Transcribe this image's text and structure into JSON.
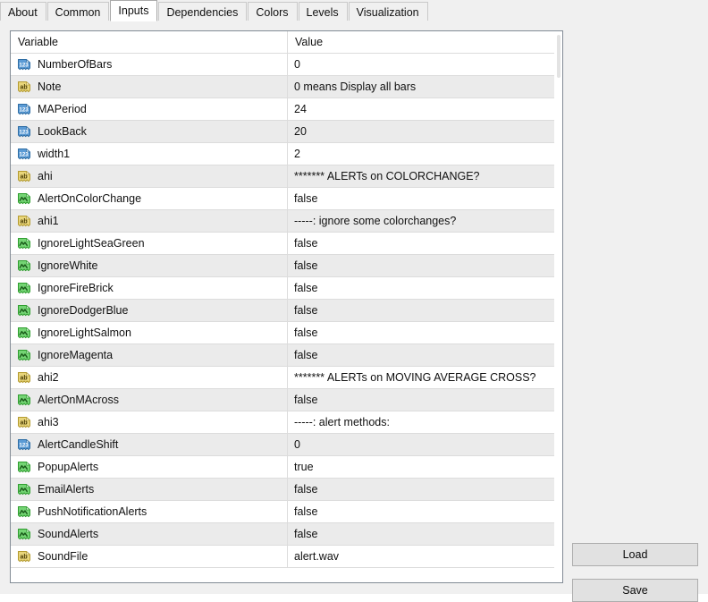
{
  "tabs": [
    {
      "label": "About",
      "active": false
    },
    {
      "label": "Common",
      "active": false
    },
    {
      "label": "Inputs",
      "active": true
    },
    {
      "label": "Dependencies",
      "active": false
    },
    {
      "label": "Colors",
      "active": false
    },
    {
      "label": "Levels",
      "active": false
    },
    {
      "label": "Visualization",
      "active": false
    }
  ],
  "grid": {
    "columns": [
      "Variable",
      "Value"
    ],
    "rows": [
      {
        "icon": "integer-type-icon",
        "name": "NumberOfBars",
        "value": "0"
      },
      {
        "icon": "string-type-icon",
        "name": "Note",
        "value": "0 means Display all bars"
      },
      {
        "icon": "integer-type-icon",
        "name": "MAPeriod",
        "value": "24"
      },
      {
        "icon": "integer-type-icon",
        "name": "LookBack",
        "value": "20"
      },
      {
        "icon": "integer-type-icon",
        "name": "width1",
        "value": "2"
      },
      {
        "icon": "string-type-icon",
        "name": "ahi",
        "value": "******* ALERTs on COLORCHANGE?"
      },
      {
        "icon": "boolean-type-icon",
        "name": "AlertOnColorChange",
        "value": "false"
      },
      {
        "icon": "string-type-icon",
        "name": "ahi1",
        "value": "-----: ignore some colorchanges?"
      },
      {
        "icon": "boolean-type-icon",
        "name": "IgnoreLightSeaGreen",
        "value": "false"
      },
      {
        "icon": "boolean-type-icon",
        "name": "IgnoreWhite",
        "value": "false"
      },
      {
        "icon": "boolean-type-icon",
        "name": "IgnoreFireBrick",
        "value": "false"
      },
      {
        "icon": "boolean-type-icon",
        "name": "IgnoreDodgerBlue",
        "value": "false"
      },
      {
        "icon": "boolean-type-icon",
        "name": "IgnoreLightSalmon",
        "value": "false"
      },
      {
        "icon": "boolean-type-icon",
        "name": "IgnoreMagenta",
        "value": "false"
      },
      {
        "icon": "string-type-icon",
        "name": "ahi2",
        "value": "******* ALERTs on MOVING AVERAGE CROSS?"
      },
      {
        "icon": "boolean-type-icon",
        "name": "AlertOnMAcross",
        "value": "false"
      },
      {
        "icon": "string-type-icon",
        "name": "ahi3",
        "value": "-----: alert methods:"
      },
      {
        "icon": "integer-type-icon",
        "name": "AlertCandleShift",
        "value": "0"
      },
      {
        "icon": "boolean-type-icon",
        "name": "PopupAlerts",
        "value": "true"
      },
      {
        "icon": "boolean-type-icon",
        "name": "EmailAlerts",
        "value": "false"
      },
      {
        "icon": "boolean-type-icon",
        "name": "PushNotificationAlerts",
        "value": "false"
      },
      {
        "icon": "boolean-type-icon",
        "name": "SoundAlerts",
        "value": "false"
      },
      {
        "icon": "string-type-icon",
        "name": "SoundFile",
        "value": "alert.wav"
      }
    ]
  },
  "buttons": {
    "load": "Load",
    "save": "Save"
  },
  "colors": {
    "integer_icon": "#5b9bd5",
    "string_icon": "#e8d57a",
    "boolean_icon": "#74d474",
    "row_alt": "#ebebeb",
    "pane_bg": "#f0f0f0",
    "grid_border": "#828b95",
    "button_face": "#e1e1e1"
  }
}
